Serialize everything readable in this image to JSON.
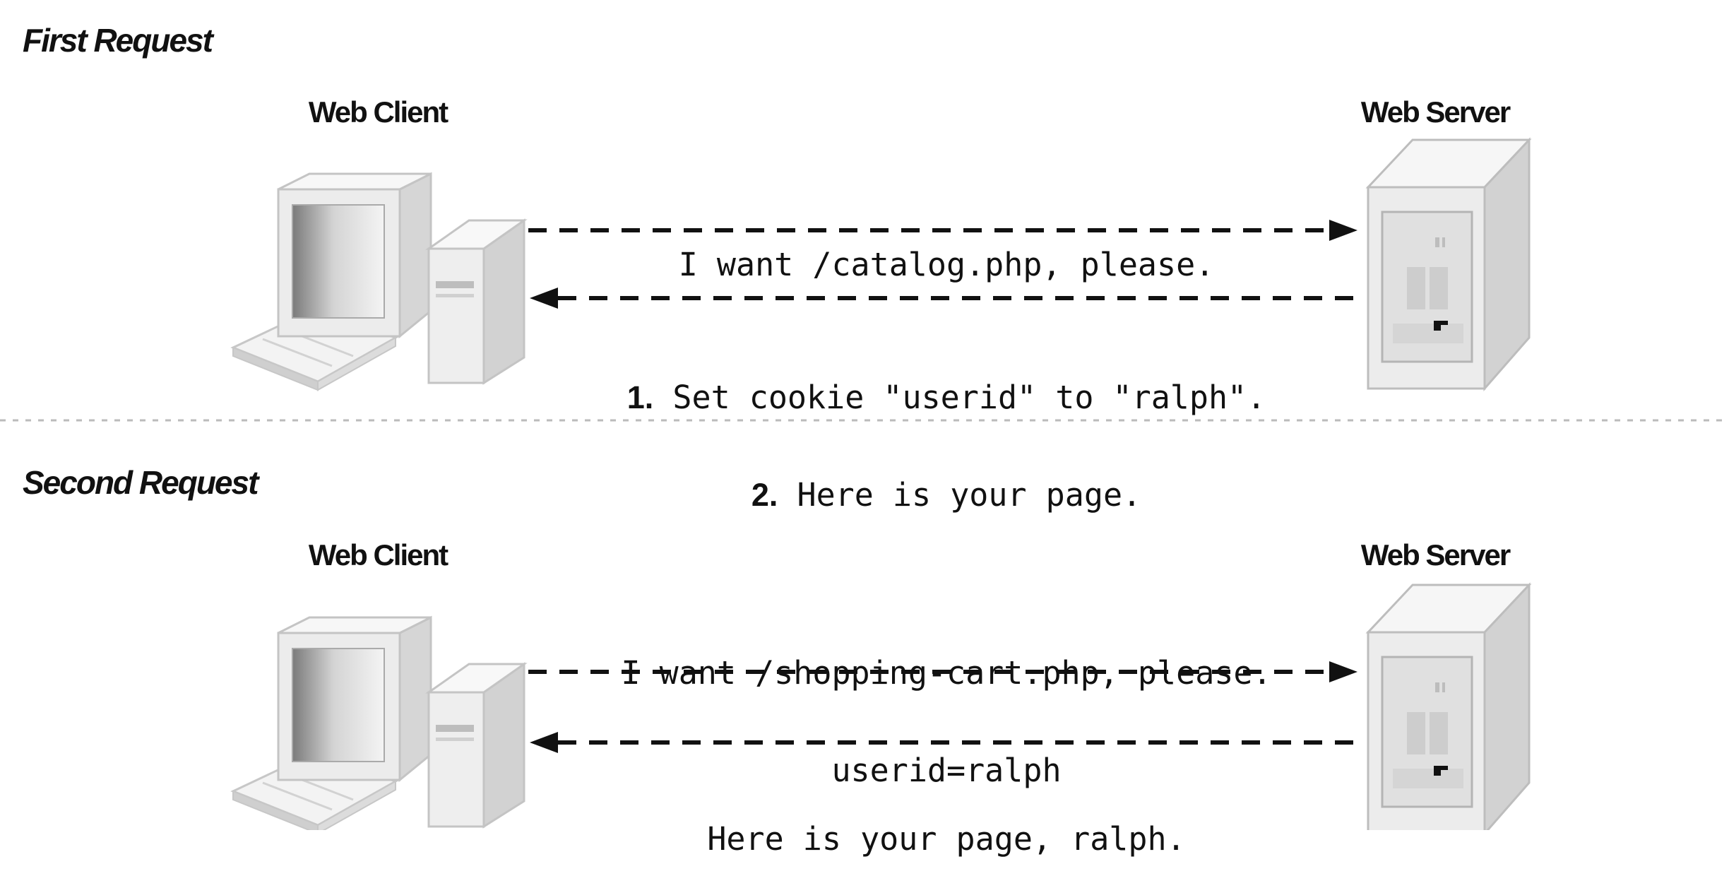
{
  "sections": [
    {
      "heading": "First Request",
      "client_label": "Web Client",
      "server_label": "Web Server",
      "request": {
        "lines": [
          "I want /catalog.php, please."
        ]
      },
      "response": {
        "lines": [
          {
            "num": "1.",
            "text": " Set cookie \"userid\" to \"ralph\"."
          },
          {
            "num": "2.",
            "text": " Here is your page."
          }
        ]
      }
    },
    {
      "heading": "Second Request",
      "client_label": "Web Client",
      "server_label": "Web Server",
      "request": {
        "lines": [
          "I want /shopping-cart.php, please.",
          "userid=ralph"
        ]
      },
      "response": {
        "lines": [
          {
            "num": "",
            "text": "Here is your page, ralph."
          }
        ]
      }
    }
  ],
  "colors": {
    "text": "#111111",
    "arrow": "#111111",
    "divider": "#bbbbbb",
    "device_light": "#f2f2f2",
    "device_mid": "#d8d8d8",
    "device_dark": "#a9a9a9"
  }
}
